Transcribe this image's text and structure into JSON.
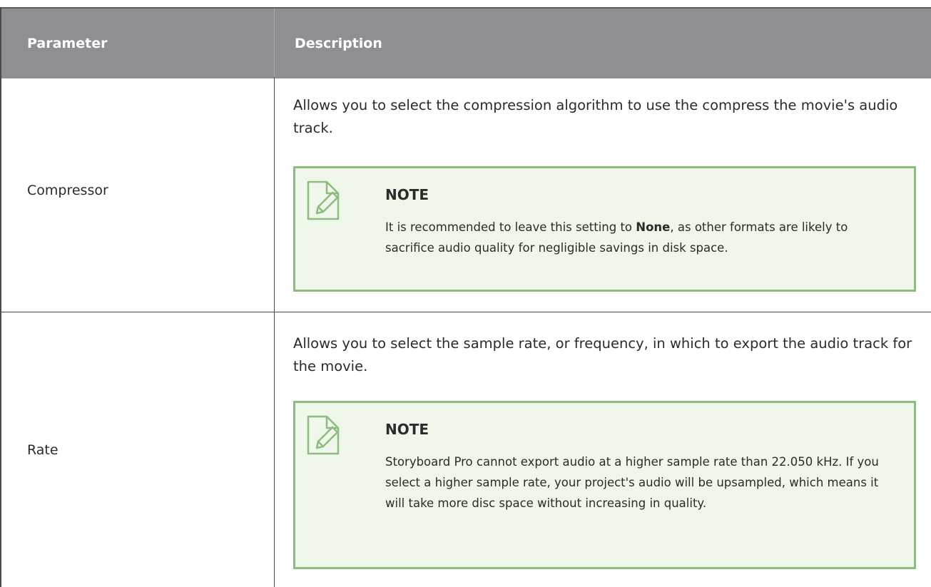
{
  "header": {
    "parameter_label": "Parameter",
    "description_label": "Description"
  },
  "rows": [
    {
      "parameter": "Compressor",
      "description": "Allows you to select the compression algorithm to use the compress the movie's audio track.",
      "note": {
        "title": "NOTE",
        "body_before": "It is recommended to leave this setting to ",
        "body_bold": "None",
        "body_after": ", as other formats are likely to sacrifice audio quality for negligible savings in disk space."
      }
    },
    {
      "parameter": "Rate",
      "description": "Allows you to select the sample rate, or frequency, in which to export the audio track for the movie.",
      "note": {
        "title": "NOTE",
        "body": "Storyboard Pro cannot export audio at a higher sample rate than 22.050 kHz. If you select a higher sample rate, your project's audio will be upsampled, which means it will take more disc space without increasing in quality."
      }
    }
  ],
  "icons": {
    "note_icon": "note-pencil-icon"
  },
  "colors": {
    "header_bg": "#8e8f93",
    "note_bg": "#eef7ea",
    "note_border": "#8cbc7e",
    "note_icon": "#8cbc7e"
  }
}
